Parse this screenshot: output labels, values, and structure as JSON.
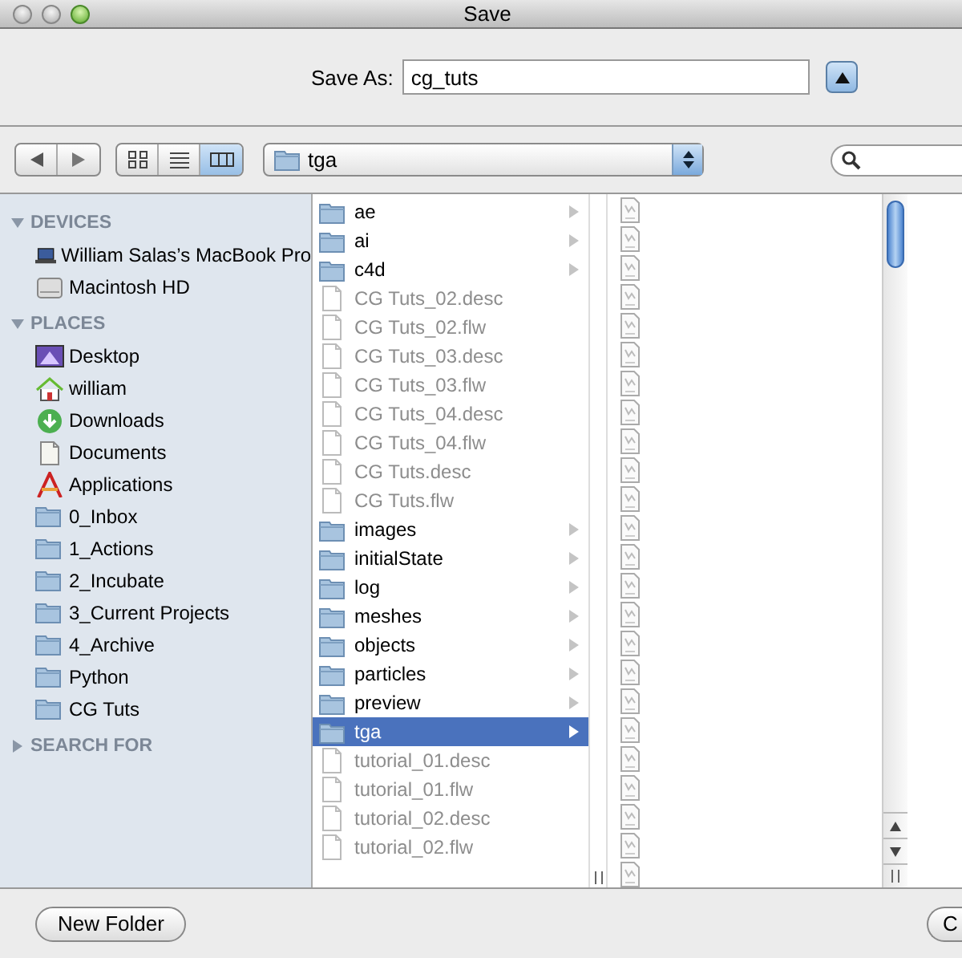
{
  "window": {
    "title": "Save"
  },
  "save_as": {
    "label": "Save As:",
    "value": "cg_tuts",
    "expanded": false
  },
  "toolbar": {
    "view_buttons": [
      {
        "kind": "icons",
        "selected": false
      },
      {
        "kind": "list",
        "selected": false
      },
      {
        "kind": "columns",
        "selected": true
      }
    ],
    "path_popup": {
      "label": "tga"
    }
  },
  "sidebar": {
    "sections": [
      {
        "title": "DEVICES",
        "expanded": true,
        "items": [
          {
            "label": "William Salas’s MacBook Pro",
            "kind": "laptop"
          },
          {
            "label": "Macintosh HD",
            "kind": "disk"
          }
        ]
      },
      {
        "title": "PLACES",
        "expanded": true,
        "items": [
          {
            "label": "Desktop",
            "kind": "desktop"
          },
          {
            "label": "william",
            "kind": "home"
          },
          {
            "label": "Downloads",
            "kind": "download"
          },
          {
            "label": "Documents",
            "kind": "documents"
          },
          {
            "label": "Applications",
            "kind": "applications"
          },
          {
            "label": "0_Inbox",
            "kind": "folder"
          },
          {
            "label": "1_Actions",
            "kind": "folder"
          },
          {
            "label": "2_Incubate",
            "kind": "folder"
          },
          {
            "label": "3_Current Projects",
            "kind": "folder"
          },
          {
            "label": "4_Archive",
            "kind": "folder"
          },
          {
            "label": "Python",
            "kind": "folder"
          },
          {
            "label": "CG Tuts",
            "kind": "folder"
          }
        ]
      },
      {
        "title": "SEARCH FOR",
        "expanded": false
      }
    ]
  },
  "columns": [
    {
      "items": [
        {
          "name": "ae",
          "kind": "folder",
          "disabled": false,
          "selected": false
        },
        {
          "name": "ai",
          "kind": "folder",
          "disabled": false,
          "selected": false
        },
        {
          "name": "c4d",
          "kind": "folder",
          "disabled": false,
          "selected": false
        },
        {
          "name": "CG Tuts_02.desc",
          "kind": "file",
          "disabled": true,
          "selected": false
        },
        {
          "name": "CG Tuts_02.flw",
          "kind": "file",
          "disabled": true,
          "selected": false
        },
        {
          "name": "CG Tuts_03.desc",
          "kind": "file",
          "disabled": true,
          "selected": false
        },
        {
          "name": "CG Tuts_03.flw",
          "kind": "file",
          "disabled": true,
          "selected": false
        },
        {
          "name": "CG Tuts_04.desc",
          "kind": "file",
          "disabled": true,
          "selected": false
        },
        {
          "name": "CG Tuts_04.flw",
          "kind": "file",
          "disabled": true,
          "selected": false
        },
        {
          "name": "CG Tuts.desc",
          "kind": "file",
          "disabled": true,
          "selected": false
        },
        {
          "name": "CG Tuts.flw",
          "kind": "file",
          "disabled": true,
          "selected": false
        },
        {
          "name": "images",
          "kind": "folder",
          "disabled": false,
          "selected": false
        },
        {
          "name": "initialState",
          "kind": "folder",
          "disabled": false,
          "selected": false
        },
        {
          "name": "log",
          "kind": "folder",
          "disabled": false,
          "selected": false
        },
        {
          "name": "meshes",
          "kind": "folder",
          "disabled": false,
          "selected": false
        },
        {
          "name": "objects",
          "kind": "folder",
          "disabled": false,
          "selected": false
        },
        {
          "name": "particles",
          "kind": "folder",
          "disabled": false,
          "selected": false
        },
        {
          "name": "preview",
          "kind": "folder",
          "disabled": false,
          "selected": false
        },
        {
          "name": "tga",
          "kind": "folder",
          "disabled": false,
          "selected": true
        },
        {
          "name": "tutorial_01.desc",
          "kind": "file",
          "disabled": true,
          "selected": false
        },
        {
          "name": "tutorial_01.flw",
          "kind": "file",
          "disabled": true,
          "selected": false
        },
        {
          "name": "tutorial_02.desc",
          "kind": "file",
          "disabled": true,
          "selected": false
        },
        {
          "name": "tutorial_02.flw",
          "kind": "file",
          "disabled": true,
          "selected": false
        }
      ]
    },
    {
      "items": [
        {
          "kind": "image-file"
        },
        {
          "kind": "image-file"
        },
        {
          "kind": "image-file"
        },
        {
          "kind": "image-file"
        },
        {
          "kind": "image-file"
        },
        {
          "kind": "image-file"
        },
        {
          "kind": "image-file"
        },
        {
          "kind": "image-file"
        },
        {
          "kind": "image-file"
        },
        {
          "kind": "image-file"
        },
        {
          "kind": "image-file"
        },
        {
          "kind": "image-file"
        },
        {
          "kind": "image-file"
        },
        {
          "kind": "image-file"
        },
        {
          "kind": "image-file"
        },
        {
          "kind": "image-file"
        },
        {
          "kind": "image-file"
        },
        {
          "kind": "image-file"
        },
        {
          "kind": "image-file"
        },
        {
          "kind": "image-file"
        },
        {
          "kind": "image-file"
        },
        {
          "kind": "image-file"
        },
        {
          "kind": "image-file"
        },
        {
          "kind": "image-file"
        }
      ]
    }
  ],
  "buttons": [
    {
      "label": "New Folder",
      "kind": "left"
    },
    {
      "label": "C",
      "kind": "right"
    }
  ]
}
